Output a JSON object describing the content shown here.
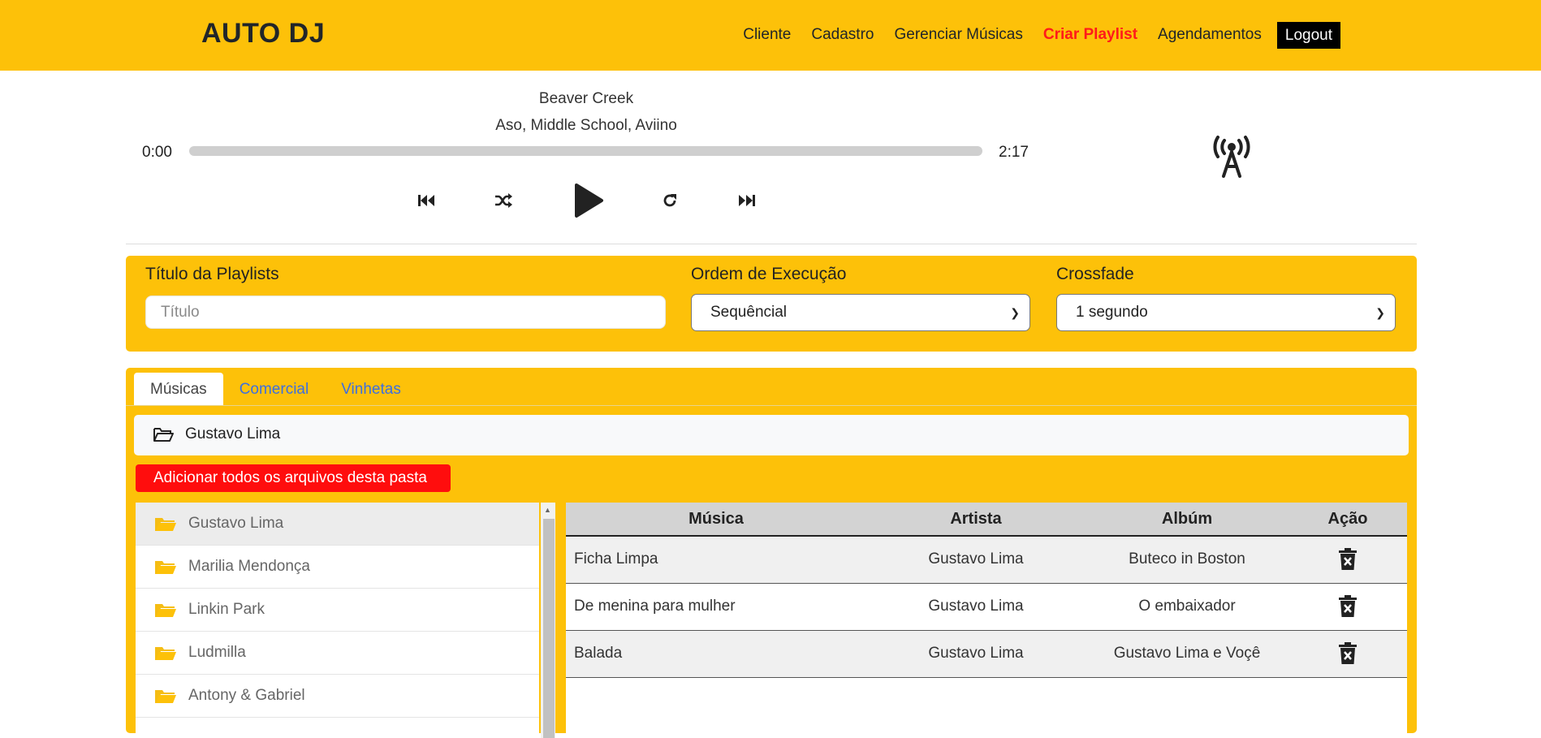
{
  "navbar": {
    "brand": "AUTO DJ",
    "links": [
      "Cliente",
      "Cadastro",
      "Gerenciar Músicas",
      "Criar Playlist",
      "Agendamentos"
    ],
    "logout": "Logout",
    "accent": "#fdc109",
    "active_color": "#ff1a1a"
  },
  "player": {
    "title": "Beaver Creek",
    "artists": "Aso, Middle School, Aviino",
    "current_time": "0:00",
    "total_time": "2:17",
    "progress": 0,
    "controls": [
      "skip-back-icon",
      "shuffle-icon",
      "play-icon",
      "repeat-icon",
      "skip-forward-icon"
    ],
    "broadcast_icon": "radio-tower-icon"
  },
  "playlist_form": {
    "title_label": "Título da Playlists",
    "title_placeholder": "Título",
    "title_value": "",
    "order_label": "Ordem de Execução",
    "order_value": "Sequêncial",
    "crossfade_label": "Crossfade",
    "crossfade_value": "1 segundo"
  },
  "library": {
    "tabs": [
      "Músicas",
      "Comercial",
      "Vinhetas"
    ],
    "active_tab": "Músicas",
    "current_folder": "Gustavo Lima",
    "add_all_label": "Adicionar todos os arquivos desta pasta",
    "folders": [
      "Gustavo Lima",
      "Marilia Mendonça",
      "Linkin Park",
      "Ludmilla",
      "Antony & Gabriel"
    ],
    "table": {
      "headers": [
        "Música",
        "Artista",
        "Albúm",
        "Ação"
      ],
      "rows": [
        [
          "Ficha Limpa",
          "Gustavo Lima",
          "Buteco in Boston"
        ],
        [
          "De menina para mulher",
          "Gustavo Lima",
          "O embaixador"
        ],
        [
          "Balada",
          "Gustavo Lima",
          "Gustavo Lima e Voçê"
        ]
      ]
    }
  }
}
